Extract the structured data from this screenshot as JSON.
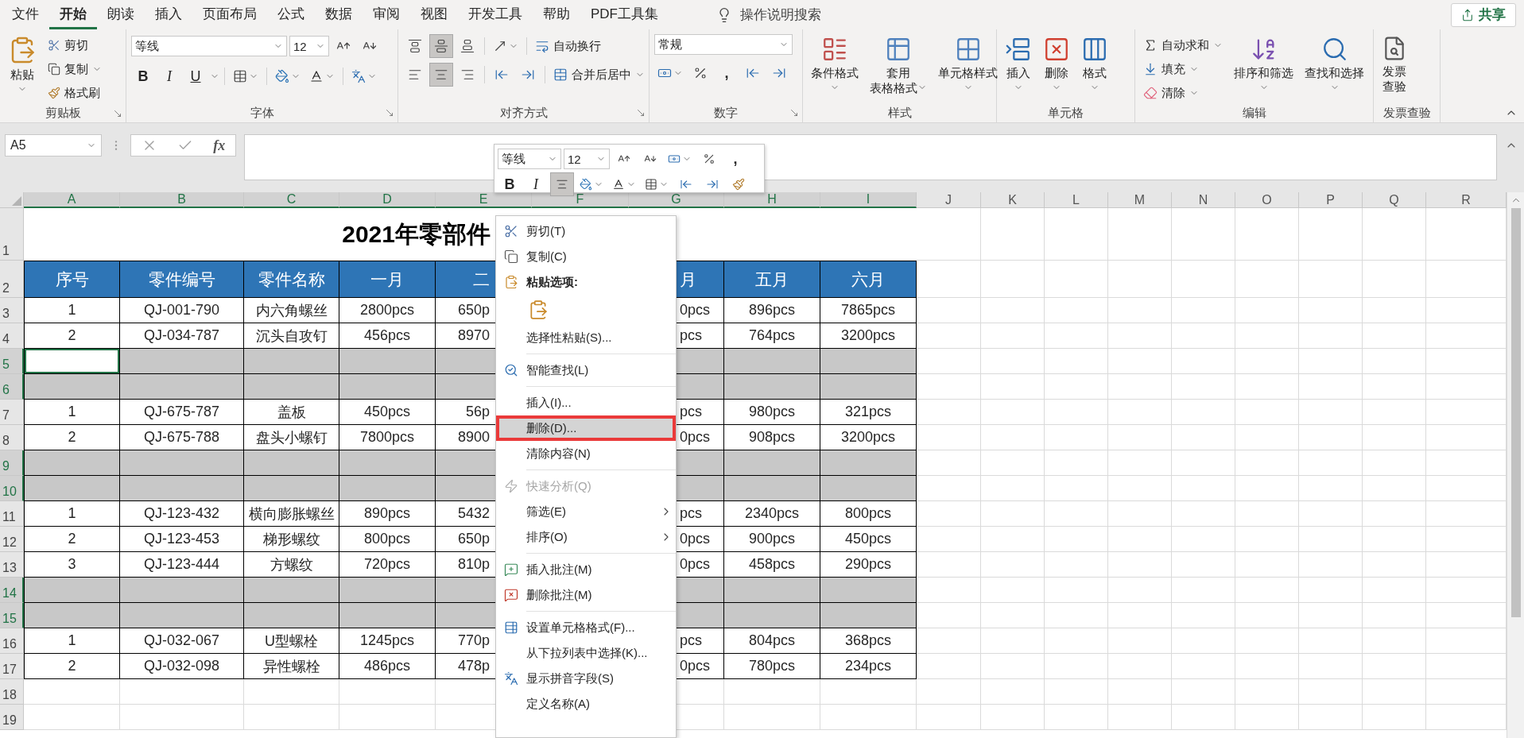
{
  "menu_tabs": [
    {
      "label": "文件",
      "selected": false
    },
    {
      "label": "开始",
      "selected": true
    },
    {
      "label": "朗读",
      "selected": false
    },
    {
      "label": "插入",
      "selected": false
    },
    {
      "label": "页面布局",
      "selected": false
    },
    {
      "label": "公式",
      "selected": false
    },
    {
      "label": "数据",
      "selected": false
    },
    {
      "label": "审阅",
      "selected": false
    },
    {
      "label": "视图",
      "selected": false
    },
    {
      "label": "开发工具",
      "selected": false
    },
    {
      "label": "帮助",
      "selected": false
    },
    {
      "label": "PDF工具集",
      "selected": false
    }
  ],
  "tell_me": {
    "placeholder": "操作说明搜索"
  },
  "share_button": "共享",
  "ribbon": {
    "clipboard": {
      "label": "剪贴板",
      "paste": "粘贴",
      "cut": "剪切",
      "copy": "复制",
      "format_painter": "格式刷"
    },
    "font": {
      "label": "字体",
      "font_name": "等线",
      "font_size": "12",
      "bold": "B",
      "italic": "I",
      "underline": "U"
    },
    "alignment": {
      "label": "对齐方式",
      "vertical": [
        {
          "selected": false
        },
        {
          "selected": true
        },
        {
          "selected": false
        }
      ],
      "horizontal": [
        {
          "selected": false
        },
        {
          "selected": true
        },
        {
          "selected": false
        }
      ],
      "wrap_text": "自动换行",
      "merge_center": "合并后居中"
    },
    "number": {
      "label": "数字",
      "format": "常规",
      "comma": ","
    },
    "styles": {
      "label": "样式",
      "buttons": [
        {
          "lines": [
            "条件格式"
          ]
        },
        {
          "lines": [
            "套用",
            "表格格式"
          ]
        },
        {
          "lines": [
            "单元格样式"
          ]
        }
      ]
    },
    "cells": {
      "label": "单元格",
      "buttons": [
        "插入",
        "删除",
        "格式"
      ]
    },
    "editing": {
      "label": "编辑",
      "autosum": "自动求和",
      "fill": "填充",
      "clear": "清除",
      "sort_filter": "排序和筛选",
      "find_select": "查找和选择"
    },
    "invoice": {
      "label": "发票查验",
      "button": [
        "发票",
        "查验"
      ]
    }
  },
  "formula_bar": {
    "name_box": "A5",
    "function_label": "fx"
  },
  "sheet": {
    "columns": [
      {
        "label": "A",
        "selected": true
      },
      {
        "label": "B",
        "selected": true
      },
      {
        "label": "C",
        "selected": true
      },
      {
        "label": "D",
        "selected": true
      },
      {
        "label": "E",
        "selected": true
      },
      {
        "label": "F",
        "selected": true
      },
      {
        "label": "G",
        "selected": true
      },
      {
        "label": "H",
        "selected": true
      },
      {
        "label": "I",
        "selected": true
      },
      {
        "label": "J",
        "selected": false
      },
      {
        "label": "K",
        "selected": false
      },
      {
        "label": "L",
        "selected": false
      },
      {
        "label": "M",
        "selected": false
      },
      {
        "label": "N",
        "selected": false
      },
      {
        "label": "O",
        "selected": false
      },
      {
        "label": "P",
        "selected": false
      },
      {
        "label": "Q",
        "selected": false
      },
      {
        "label": "R",
        "selected": false
      }
    ],
    "title_row": {
      "number": "1",
      "title": "2021年零部件"
    },
    "header_row": {
      "number": "2",
      "cells": [
        "序号",
        "零件编号",
        "零件名称",
        "一月",
        "二",
        "月",
        "五月",
        "六月"
      ]
    },
    "rows": [
      {
        "number": "3",
        "kind": "table",
        "selected": false,
        "cells": [
          "1",
          "QJ-001-790",
          "内六角螺丝",
          "2800pcs",
          "650p",
          "0pcs",
          "896pcs",
          "7865pcs"
        ]
      },
      {
        "number": "4",
        "kind": "table",
        "selected": false,
        "cells": [
          "2",
          "QJ-034-787",
          "沉头自攻钉",
          "456pcs",
          "8970",
          "pcs",
          "764pcs",
          "3200pcs"
        ]
      },
      {
        "number": "5",
        "kind": "table",
        "selected": true,
        "active": true
      },
      {
        "number": "6",
        "kind": "table",
        "selected": true
      },
      {
        "number": "7",
        "kind": "table",
        "selected": false,
        "cells": [
          "1",
          "QJ-675-787",
          "盖板",
          "450pcs",
          "56p",
          "pcs",
          "980pcs",
          "321pcs"
        ]
      },
      {
        "number": "8",
        "kind": "table",
        "selected": false,
        "cells": [
          "2",
          "QJ-675-788",
          "盘头小螺钉",
          "7800pcs",
          "8900",
          "0pcs",
          "908pcs",
          "3200pcs"
        ]
      },
      {
        "number": "9",
        "kind": "table",
        "selected": true
      },
      {
        "number": "10",
        "kind": "table",
        "selected": true
      },
      {
        "number": "11",
        "kind": "table",
        "selected": false,
        "cells": [
          "1",
          "QJ-123-432",
          "横向膨胀螺丝",
          "890pcs",
          "5432",
          "pcs",
          "2340pcs",
          "800pcs"
        ]
      },
      {
        "number": "12",
        "kind": "table",
        "selected": false,
        "cells": [
          "2",
          "QJ-123-453",
          "梯形螺纹",
          "800pcs",
          "650p",
          "0pcs",
          "900pcs",
          "450pcs"
        ]
      },
      {
        "number": "13",
        "kind": "table",
        "selected": false,
        "cells": [
          "3",
          "QJ-123-444",
          "方螺纹",
          "720pcs",
          "810p",
          "0pcs",
          "458pcs",
          "290pcs"
        ]
      },
      {
        "number": "14",
        "kind": "table",
        "selected": true
      },
      {
        "number": "15",
        "kind": "table",
        "selected": true
      },
      {
        "number": "16",
        "kind": "table",
        "selected": false,
        "cells": [
          "1",
          "QJ-032-067",
          "U型螺栓",
          "1245pcs",
          "770p",
          "pcs",
          "804pcs",
          "368pcs"
        ]
      },
      {
        "number": "17",
        "kind": "table",
        "selected": false,
        "cells": [
          "2",
          "QJ-032-098",
          "异性螺栓",
          "486pcs",
          "478p",
          "0pcs",
          "780pcs",
          "234pcs"
        ]
      },
      {
        "number": "18",
        "kind": "plain",
        "selected": false
      },
      {
        "number": "19",
        "kind": "plain",
        "selected": false
      }
    ]
  },
  "mini_toolbar": {
    "font_name": "等线",
    "font_size": "12",
    "comma": ",",
    "bold": "B",
    "italic": "I",
    "center_align": {
      "selected": true
    }
  },
  "context_menu": {
    "items": [
      {
        "kind": "command",
        "label": "剪切(T)",
        "selected": false,
        "disabled": false,
        "boxed": false
      },
      {
        "kind": "command",
        "label": "复制(C)",
        "selected": false,
        "disabled": false,
        "boxed": false
      },
      {
        "kind": "header",
        "label": "粘贴选项:"
      },
      {
        "kind": "paste_options"
      },
      {
        "kind": "command",
        "label": "选择性粘贴(S)...",
        "selected": false,
        "disabled": false,
        "boxed": false
      },
      {
        "kind": "separator"
      },
      {
        "kind": "command",
        "label": "智能查找(L)",
        "selected": false,
        "disabled": false,
        "boxed": false
      },
      {
        "kind": "separator"
      },
      {
        "kind": "command",
        "label": "插入(I)...",
        "selected": false,
        "disabled": false,
        "boxed": false
      },
      {
        "kind": "command",
        "label": "删除(D)...",
        "selected": true,
        "disabled": false,
        "boxed": true
      },
      {
        "kind": "command",
        "label": "清除内容(N)",
        "selected": false,
        "disabled": false,
        "boxed": false
      },
      {
        "kind": "separator"
      },
      {
        "kind": "command",
        "label": "快速分析(Q)",
        "selected": false,
        "disabled": true,
        "boxed": false
      },
      {
        "kind": "submenu",
        "label": "筛选(E)",
        "selected": false,
        "disabled": false,
        "boxed": false
      },
      {
        "kind": "submenu",
        "label": "排序(O)",
        "selected": false,
        "disabled": false,
        "boxed": false
      },
      {
        "kind": "separator"
      },
      {
        "kind": "command",
        "label": "插入批注(M)",
        "selected": false,
        "disabled": false,
        "boxed": false
      },
      {
        "kind": "command",
        "label": "删除批注(M)",
        "selected": false,
        "disabled": false,
        "boxed": false
      },
      {
        "kind": "separator"
      },
      {
        "kind": "command",
        "label": "设置单元格格式(F)...",
        "selected": false,
        "disabled": false,
        "boxed": false
      },
      {
        "kind": "command",
        "label": "从下拉列表中选择(K)...",
        "selected": false,
        "disabled": false,
        "boxed": false
      },
      {
        "kind": "command",
        "label": "显示拼音字段(S)",
        "selected": false,
        "disabled": false,
        "boxed": false
      },
      {
        "kind": "command",
        "label": "定义名称(A)",
        "selected": false,
        "disabled": false,
        "boxed": false
      }
    ]
  }
}
